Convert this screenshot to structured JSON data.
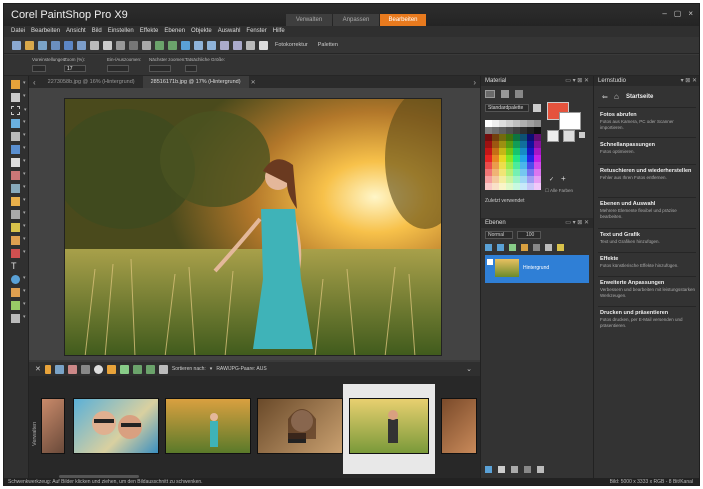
{
  "app": {
    "title": "Corel PaintShop Pro X9"
  },
  "mode_tabs": [
    {
      "label": "Verwalten",
      "active": false
    },
    {
      "label": "Anpassen",
      "active": false
    },
    {
      "label": "Bearbeiten",
      "active": true
    }
  ],
  "window_controls": [
    "–",
    "▢",
    "×"
  ],
  "menu": [
    "Datei",
    "Bearbeiten",
    "Ansicht",
    "Bild",
    "Einstellen",
    "Effekte",
    "Ebenen",
    "Objekte",
    "Auswahl",
    "Fenster",
    "Hilfe"
  ],
  "toolbar": {
    "fotokorrektur": "Fotokorrektur",
    "paletten": "Paletten"
  },
  "tool_options": {
    "voreinstellungen": "Voreinstellungen:",
    "zoom_label": "Zoom (%):",
    "zoom_value": "17",
    "einzoomen": "Ein-/Auszoomen:",
    "naechster_zoom": "Nächster zoomen:",
    "tatsaechliche": "Tatsächliche Größe:"
  },
  "doc_tabs": [
    {
      "label": "2273058b.jpg @ 16% (Hintergrund)",
      "active": false
    },
    {
      "label": "28516171b.jpg @ 17% (Hintergrund)",
      "active": true
    }
  ],
  "organizer": {
    "sort_label": "Sortieren nach:",
    "raw_label": "RAW/JPG-Paare: AUS",
    "side_label": "Verwalten"
  },
  "material_panel": {
    "title": "Material",
    "palette_select": "Standardpalette",
    "recent_label": "Zuletzt verwendet",
    "alle_farben": "Alle Farben",
    "fg_color": "#e5533d",
    "bg_color": "#ffffff"
  },
  "layers_panel": {
    "title": "Ebenen",
    "blend_mode": "Normal",
    "opacity": "100",
    "layer_name": "Hintergrund"
  },
  "learning_center": {
    "title": "Lernstudio",
    "home_label": "Startseite",
    "items": [
      {
        "title": "Fotos abrufen",
        "desc": "Fotos aus Kamera, PC oder Scanner importieren."
      },
      {
        "title": "Schnellanpassungen",
        "desc": "Fotos optimieren."
      },
      {
        "title": "Retuschieren und wiederherstellen",
        "desc": "Fehler aus Ihren Fotos entfernen."
      },
      {
        "title": "Ebenen und Auswahl",
        "desc": "Mehrere Elemente flexibel und präzise bearbeiten."
      },
      {
        "title": "Text und Grafik",
        "desc": "Text und Grafiken hinzufügen."
      },
      {
        "title": "Effekte",
        "desc": "Fotos künstlerische Effekte hinzufügen."
      },
      {
        "title": "Erweiterte Anpassungen",
        "desc": "Verbessern und bearbeiten mit leistungsstarken Werkzeugen."
      },
      {
        "title": "Drucken und präsentieren",
        "desc": "Fotos drucken, per E-Mail versenden und präsentieren."
      }
    ]
  },
  "status": {
    "left": "Schwenkwerkzeug: Auf Bilder klicken und ziehen, um den Bildausschnitt zu schwenken.",
    "right": "Bild: 5000 x 3333 x RGB - 8 Bit/Kanal"
  }
}
